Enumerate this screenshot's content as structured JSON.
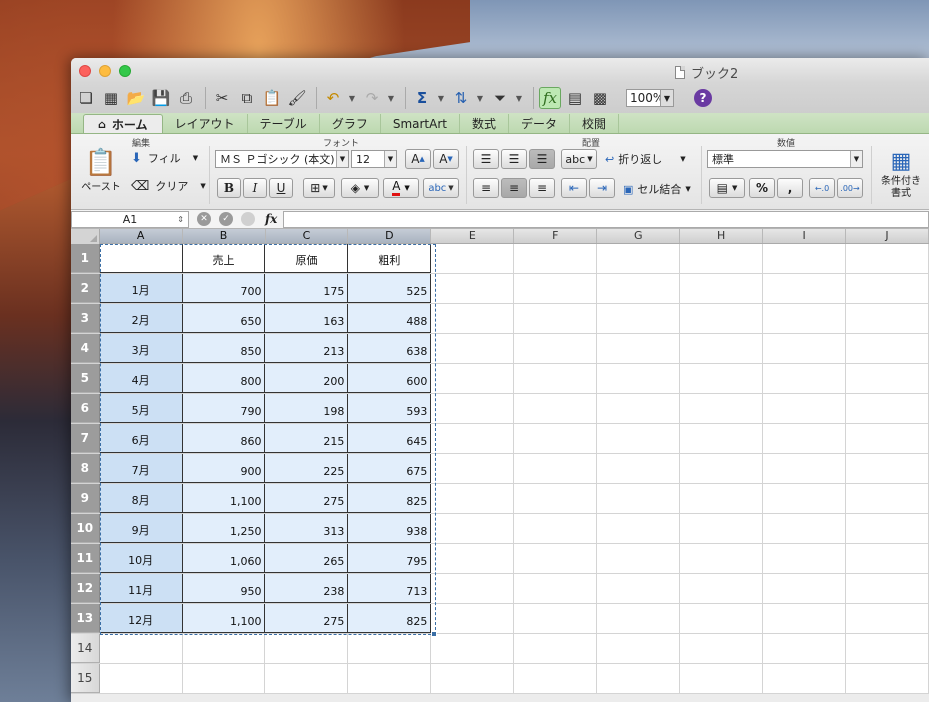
{
  "window": {
    "title": "ブック2"
  },
  "toolbar": {
    "zoom": "100%",
    "help": "?"
  },
  "tabs": [
    {
      "label": "ホーム",
      "active": true
    },
    {
      "label": "レイアウト"
    },
    {
      "label": "テーブル"
    },
    {
      "label": "グラフ"
    },
    {
      "label": "SmartArt"
    },
    {
      "label": "数式"
    },
    {
      "label": "データ"
    },
    {
      "label": "校閲"
    }
  ],
  "ribbon": {
    "edit_title": "編集",
    "paste_label": "ペースト",
    "fill_label": "フィル",
    "clear_label": "クリア",
    "font_title": "フォント",
    "font_name": "ＭＳ Ｐゴシック (本文)",
    "font_size": "12",
    "align_title": "配置",
    "wrap_label": "折り返し",
    "merge_label": "セル結合",
    "abc_label": "abc",
    "number_title": "数値",
    "number_format": "標準",
    "cond_format_label": "条件付き書式",
    "dec_inc": ".0 .00",
    "dec_dec": ".00 .0"
  },
  "formula_bar": {
    "cell_ref": "A1",
    "fx": "fx",
    "value": ""
  },
  "sheet": {
    "columns": [
      "A",
      "B",
      "C",
      "D",
      "E",
      "F",
      "G",
      "H",
      "I",
      "J"
    ],
    "header_row": [
      "",
      "売上",
      "原価",
      "粗利"
    ],
    "rows": [
      {
        "n": "1"
      },
      {
        "n": "2",
        "cells": [
          "1月",
          "700",
          "175",
          "525"
        ]
      },
      {
        "n": "3",
        "cells": [
          "2月",
          "650",
          "163",
          "488"
        ]
      },
      {
        "n": "4",
        "cells": [
          "3月",
          "850",
          "213",
          "638"
        ]
      },
      {
        "n": "5",
        "cells": [
          "4月",
          "800",
          "200",
          "600"
        ]
      },
      {
        "n": "6",
        "cells": [
          "5月",
          "790",
          "198",
          "593"
        ]
      },
      {
        "n": "7",
        "cells": [
          "6月",
          "860",
          "215",
          "645"
        ]
      },
      {
        "n": "8",
        "cells": [
          "7月",
          "900",
          "225",
          "675"
        ]
      },
      {
        "n": "9",
        "cells": [
          "8月",
          "1,100",
          "275",
          "825"
        ]
      },
      {
        "n": "10",
        "cells": [
          "9月",
          "1,250",
          "313",
          "938"
        ]
      },
      {
        "n": "11",
        "cells": [
          "10月",
          "1,060",
          "265",
          "795"
        ]
      },
      {
        "n": "12",
        "cells": [
          "11月",
          "950",
          "238",
          "713"
        ]
      },
      {
        "n": "13",
        "cells": [
          "12月",
          "1,100",
          "275",
          "825"
        ]
      },
      {
        "n": "14"
      },
      {
        "n": "15"
      }
    ]
  }
}
